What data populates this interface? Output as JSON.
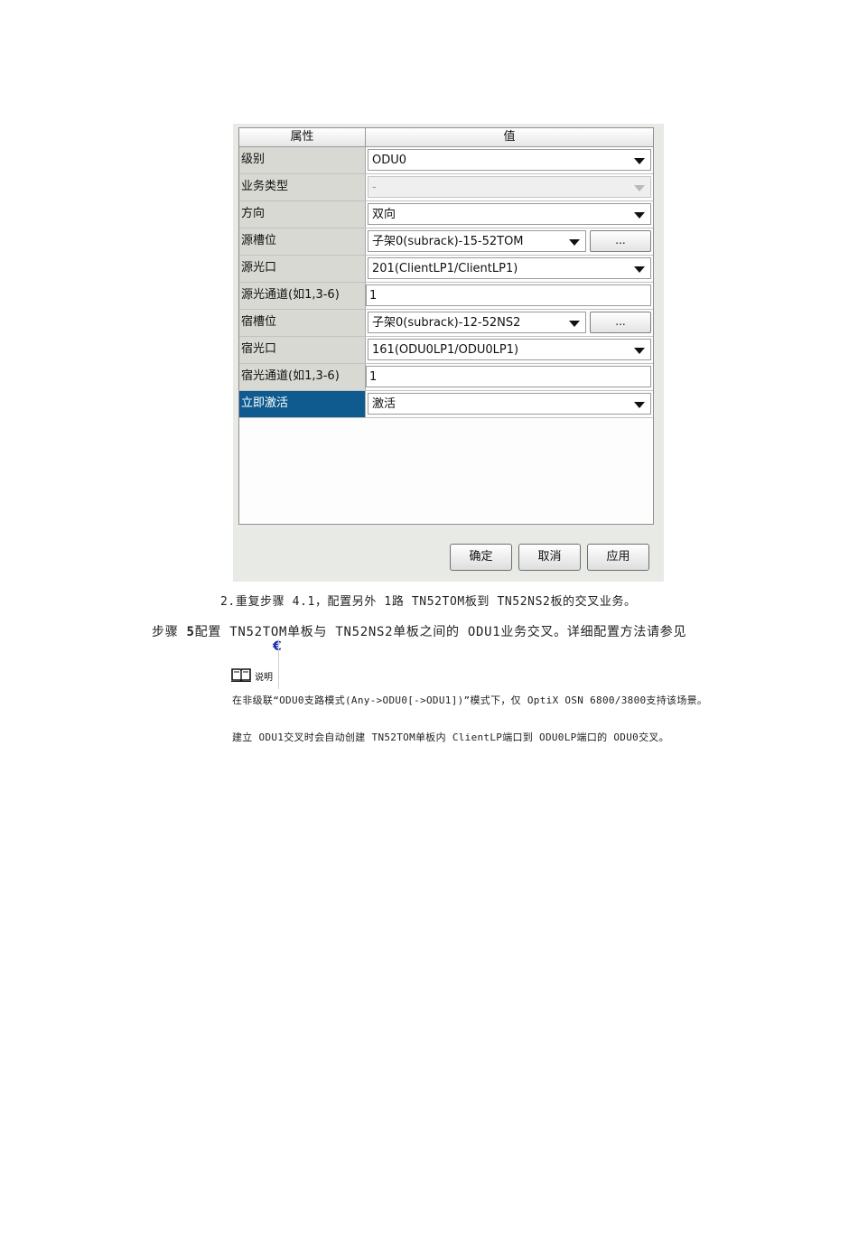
{
  "dialog": {
    "header": {
      "property": "属性",
      "value": "值"
    },
    "rows": [
      {
        "label": "级别",
        "value": "ODU0"
      },
      {
        "label": "业务类型",
        "value": "-"
      },
      {
        "label": "方向",
        "value": "双向"
      },
      {
        "label": "源槽位",
        "value": "子架0(subrack)-15-52TOM",
        "button": "..."
      },
      {
        "label": "源光口",
        "value": "201(ClientLP1/ClientLP1)"
      },
      {
        "label": "源光通道(如1,3-6)",
        "value": "1"
      },
      {
        "label": "宿槽位",
        "value": "子架0(subrack)-12-52NS2",
        "button": "..."
      },
      {
        "label": "宿光口",
        "value": "161(ODU0LP1/ODU0LP1)"
      },
      {
        "label": "宿光通道(如1,3-6)",
        "value": "1"
      },
      {
        "label": "立即激活",
        "value": "激活"
      }
    ],
    "buttons": {
      "ok": "确定",
      "cancel": "取消",
      "apply": "应用"
    }
  },
  "doc": {
    "step2": "2.重复步骤 4.1，配置另外 1路 TN52TOM板到 TN52NS2板的交叉业务。",
    "step5_prefix": "步骤 ",
    "step5_num": "5",
    "step5_text": "配置 TN52TOM单板与 TN52NS2单板之间的 ODU1业务交叉。详细配置方法请参见",
    "note_mark": "€",
    "note_label": "说明",
    "note1": "在非级联“ODU0支路模式(Any->ODU0[->ODU1])”模式下，仅 OptiX OSN 6800/3800支持该场景。",
    "note2": "建立 ODU1交叉时会自动创建 TN52TOM单板内 ClientLP端口到 ODU0LP端口的 ODU0交叉。"
  }
}
